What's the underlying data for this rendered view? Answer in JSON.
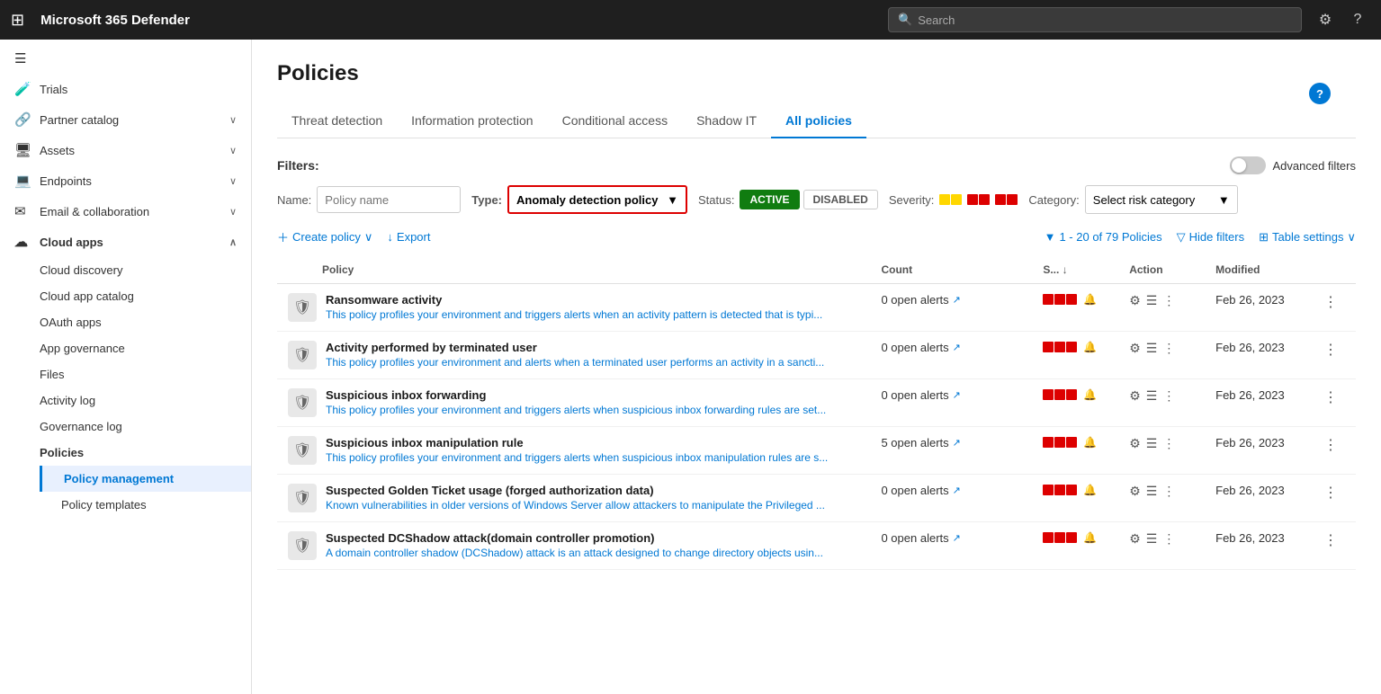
{
  "topbar": {
    "title": "Microsoft 365 Defender",
    "search_placeholder": "Search"
  },
  "sidebar": {
    "items": [
      {
        "id": "trials",
        "label": "Trials",
        "icon": "🧪",
        "expandable": false
      },
      {
        "id": "partner-catalog",
        "label": "Partner catalog",
        "icon": "🔗",
        "expandable": true
      },
      {
        "id": "assets",
        "label": "Assets",
        "icon": "🖥",
        "expandable": true
      },
      {
        "id": "endpoints",
        "label": "Endpoints",
        "icon": "💻",
        "expandable": true
      },
      {
        "id": "email-collab",
        "label": "Email & collaboration",
        "icon": "✉",
        "expandable": true
      },
      {
        "id": "cloud-apps",
        "label": "Cloud apps",
        "icon": "☁",
        "expandable": true,
        "expanded": true
      }
    ],
    "cloud_apps_children": [
      {
        "id": "cloud-discovery",
        "label": "Cloud discovery"
      },
      {
        "id": "cloud-app-catalog",
        "label": "Cloud app catalog"
      },
      {
        "id": "oauth-apps",
        "label": "OAuth apps"
      },
      {
        "id": "app-governance",
        "label": "App governance"
      },
      {
        "id": "files",
        "label": "Files"
      },
      {
        "id": "activity-log",
        "label": "Activity log"
      },
      {
        "id": "governance-log",
        "label": "Governance log"
      },
      {
        "id": "policies",
        "label": "Policies",
        "active_parent": true
      },
      {
        "id": "policy-management",
        "label": "Policy management",
        "active": true
      },
      {
        "id": "policy-templates",
        "label": "Policy templates"
      }
    ]
  },
  "page": {
    "title": "Policies",
    "help_label": "?"
  },
  "tabs": [
    {
      "id": "threat-detection",
      "label": "Threat detection",
      "active": false
    },
    {
      "id": "information-protection",
      "label": "Information protection",
      "active": false
    },
    {
      "id": "conditional-access",
      "label": "Conditional access",
      "active": false
    },
    {
      "id": "shadow-it",
      "label": "Shadow IT",
      "active": false
    },
    {
      "id": "all-policies",
      "label": "All policies",
      "active": true
    }
  ],
  "filters": {
    "label": "Filters:",
    "name_label": "Name:",
    "name_placeholder": "Policy name",
    "type_label": "Type:",
    "type_value": "Anomaly detection policy",
    "status_label": "Status:",
    "status_active": "ACTIVE",
    "status_disabled": "DISABLED",
    "severity_label": "Severity:",
    "category_label": "Category:",
    "category_value": "Select risk category",
    "advanced_filters_label": "Advanced filters"
  },
  "toolbar": {
    "create_label": "Create policy",
    "export_label": "Export",
    "count_text": "1 - 20 of 79 Policies",
    "hide_filters_label": "Hide filters",
    "table_settings_label": "Table settings"
  },
  "table": {
    "headers": [
      "Policy",
      "Count",
      "S...",
      "Action",
      "Modified"
    ],
    "rows": [
      {
        "id": "row1",
        "name": "Ransomware activity",
        "description": "This policy profiles your environment and triggers alerts when an activity pattern is detected that is typi...",
        "count": "0 open alerts",
        "severity": "high",
        "modified": "Feb 26, 2023"
      },
      {
        "id": "row2",
        "name": "Activity performed by terminated user",
        "description": "This policy profiles your environment and alerts when a terminated user performs an activity in a sancti...",
        "count": "0 open alerts",
        "severity": "high",
        "modified": "Feb 26, 2023"
      },
      {
        "id": "row3",
        "name": "Suspicious inbox forwarding",
        "description": "This policy profiles your environment and triggers alerts when suspicious inbox forwarding rules are set...",
        "count": "0 open alerts",
        "severity": "high",
        "modified": "Feb 26, 2023"
      },
      {
        "id": "row4",
        "name": "Suspicious inbox manipulation rule",
        "description": "This policy profiles your environment and triggers alerts when suspicious inbox manipulation rules are s...",
        "count": "5 open alerts",
        "severity": "high",
        "modified": "Feb 26, 2023"
      },
      {
        "id": "row5",
        "name": "Suspected Golden Ticket usage (forged authorization data)",
        "description": "Known vulnerabilities in older versions of Windows Server allow attackers to manipulate the Privileged ...",
        "count": "0 open alerts",
        "severity": "high",
        "modified": "Feb 26, 2023"
      },
      {
        "id": "row6",
        "name": "Suspected DCShadow attack(domain controller promotion)",
        "description": "A domain controller shadow (DCShadow) attack is an attack designed to change directory objects usin...",
        "count": "0 open alerts",
        "severity": "high",
        "modified": "Feb 26, 2023"
      }
    ]
  }
}
